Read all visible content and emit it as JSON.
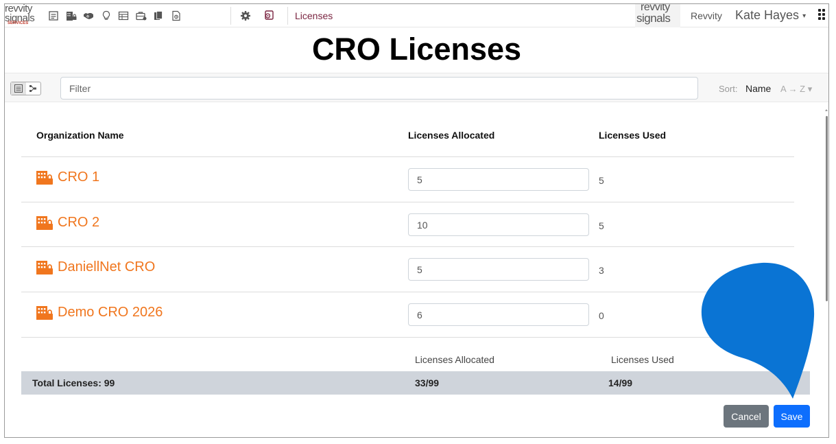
{
  "navbar": {
    "brand_left_line1": "revvity",
    "brand_left_line2": "signals",
    "brand_left_tag": "SERVICES",
    "icons": [
      "dashboard-icon",
      "building-lock-icon",
      "handshake-icon",
      "lightbulb-icon",
      "table-icon",
      "briefcase-icon",
      "files-icon",
      "document-icon"
    ],
    "admin_icons": [
      "gear-icon",
      "license-icon"
    ],
    "section_title": "Licenses",
    "brand_right_line1": "revvity",
    "brand_right_line2": "signals",
    "org_name": "Revvity",
    "user_name": "Kate Hayes",
    "user_caret": "▾"
  },
  "page": {
    "title": "CRO Licenses"
  },
  "filterbar": {
    "filter_placeholder": "Filter",
    "sort_label": "Sort:",
    "sort_value": "Name",
    "sort_direction": "A → Z ▾"
  },
  "table": {
    "headers": {
      "org": "Organization Name",
      "allocated": "Licenses Allocated",
      "used": "Licenses Used"
    },
    "rows": [
      {
        "name": "CRO 1",
        "allocated": "5",
        "used": "5"
      },
      {
        "name": "CRO 2",
        "allocated": "10",
        "used": "5"
      },
      {
        "name": "DaniellNet CRO",
        "allocated": "5",
        "used": "3"
      },
      {
        "name": "Demo CRO 2026",
        "allocated": "6",
        "used": "0"
      }
    ]
  },
  "totals": {
    "sub_allocated": "Licenses Allocated",
    "sub_used": "Licenses Used",
    "label": "Total Licenses: 99",
    "allocated": "33/99",
    "used": "14/99"
  },
  "actions": {
    "cancel": "Cancel",
    "save": "Save"
  },
  "colors": {
    "org_link": "#f0761e",
    "save": "#0d6efd",
    "cancel": "#6c757d",
    "totals_bar": "#cfd4db",
    "overlay_blob": "#0a74d4"
  }
}
